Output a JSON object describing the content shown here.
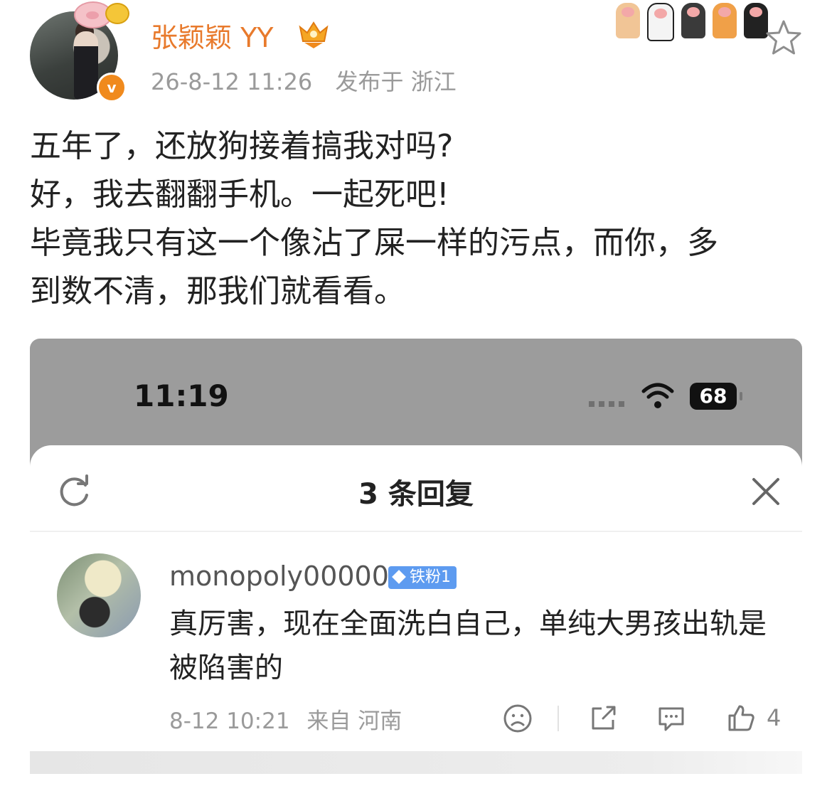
{
  "post": {
    "author": "张颖颖 YY",
    "timestamp": "26-8-12 11:26",
    "location": "发布于 浙江",
    "lines": [
      "五年了，还放狗接着搞我对吗?",
      "好，我去翻翻手机。一起死吧!",
      "毕竟我只有这一个像沾了屎一样的污点，而你，多",
      "到数不清，那我们就看看。"
    ],
    "icons": [
      "pig-icon",
      "coin-icon",
      "verified-icon",
      "vip-crown-icon",
      "paw-icon",
      "star-icon"
    ],
    "verified_glyph": "v"
  },
  "screenshot": {
    "status_time": "11:19",
    "battery": "68",
    "sheet_title": "3 条回复",
    "comment": {
      "username": "monopoly00000",
      "badge": "铁粉1",
      "text": "真厉害，现在全面洗白自己，单纯大男孩出轨是被陷害的",
      "time": "8-12 10:21",
      "location": "来自 河南",
      "likes": "4"
    }
  },
  "colors": {
    "author": "#e87a2c",
    "meta": "#9a9a9a",
    "badge": "#5d9bf0",
    "screenshot_bg": "#9c9c9c"
  }
}
